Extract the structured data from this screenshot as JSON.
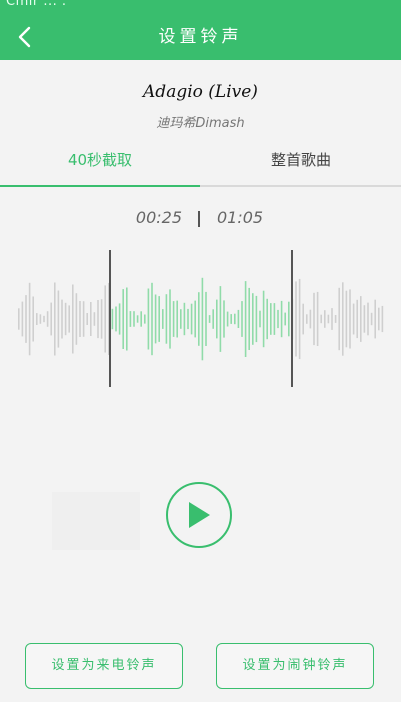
{
  "status_bar": {
    "text": "Cmir ... ."
  },
  "header": {
    "title": "设置铃声"
  },
  "song": {
    "title": "Adagio (Live)",
    "artist": "迪玛希Dimash"
  },
  "tabs": [
    {
      "label": "40秒截取",
      "active": true
    },
    {
      "label": "整首歌曲",
      "active": false
    }
  ],
  "time": {
    "start": "00:25",
    "end": "01:05"
  },
  "buttons": {
    "set_ringtone": "设置为来电铃声",
    "set_alarm": "设置为闹钟铃声"
  },
  "colors": {
    "accent": "#39be6e",
    "wave_inactive": "#cfcfcf",
    "wave_active": "#90dba9",
    "marker": "#555555"
  }
}
